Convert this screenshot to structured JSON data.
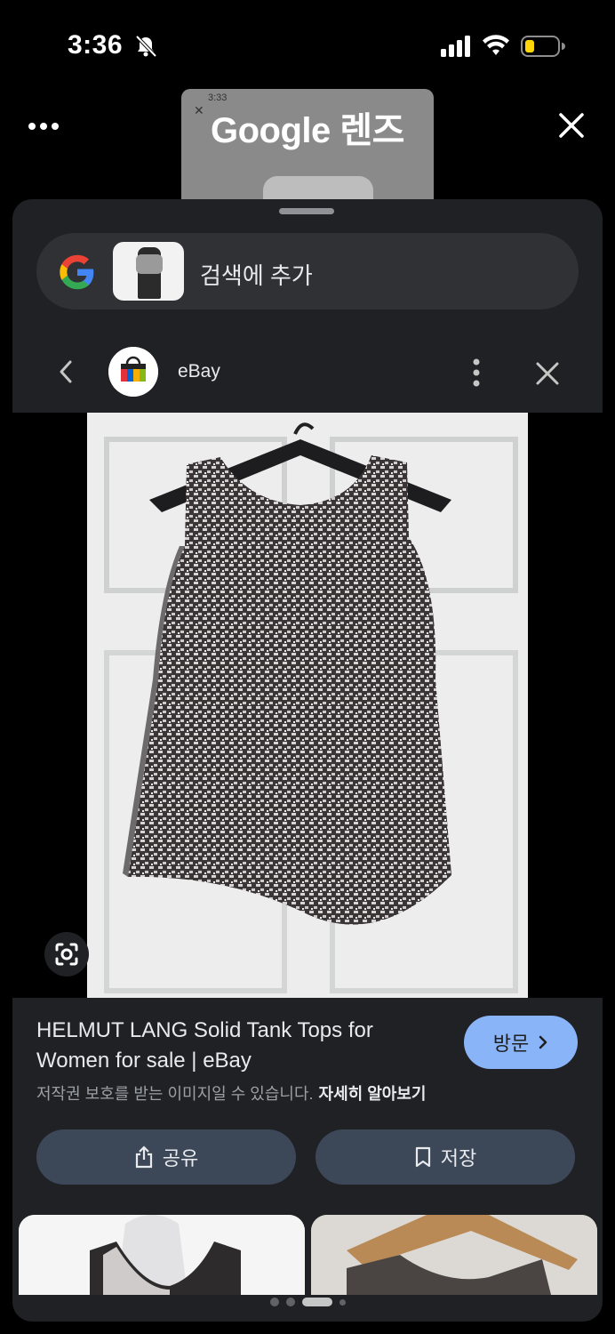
{
  "status_bar": {
    "time": "3:36"
  },
  "header": {
    "title": "Google 렌즈"
  },
  "background_preview": {
    "time": "3:33"
  },
  "search_bar": {
    "add_to_search": "검색에 추가"
  },
  "site": {
    "name": "eBay"
  },
  "result": {
    "title": "HELMUT LANG Solid Tank Tops for Women for sale | eBay",
    "copyright_notice": "저작권 보호를 받는 이미지일 수 있습니다.",
    "learn_more": "자세히 알아보기",
    "visit_label": "방문",
    "share_label": "공유",
    "save_label": "저장"
  },
  "pagination": {
    "current": 3,
    "total": 4
  },
  "colors": {
    "accent": "#8ab4f8",
    "sheet_bg": "#202124",
    "button_bg": "#3c4758",
    "text": "#e8eaed",
    "muted": "#9aa0a6"
  },
  "icons": [
    "bell-off-icon",
    "signal-icon",
    "wifi-icon",
    "battery-icon",
    "more-horizontal-icon",
    "close-icon",
    "google-g-icon",
    "chevron-left-icon",
    "more-vertical-icon",
    "lens-crop-icon",
    "chevron-right-icon",
    "share-icon",
    "bookmark-icon"
  ]
}
